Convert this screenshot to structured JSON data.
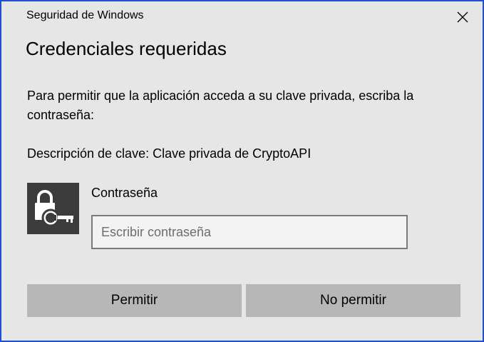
{
  "window": {
    "title": "Seguridad de Windows"
  },
  "dialog": {
    "heading": "Credenciales requeridas",
    "message": "Para permitir que la aplicación acceda a su clave privada, escriba la contraseña:",
    "key_description": "Descripción de clave: Clave privada de CryptoAPI",
    "password_label": "Contraseña",
    "password_value": "",
    "password_placeholder": "Escribir contraseña",
    "key_icon": "lock-key-icon"
  },
  "buttons": {
    "allow_label": "Permitir",
    "deny_label": "No permitir",
    "close_icon": "close-icon"
  },
  "colors": {
    "background": "#e6e6e6",
    "border_accent": "#1f4fd6",
    "button": "#b7b7b7",
    "icon_tile": "#3c3c3c"
  }
}
